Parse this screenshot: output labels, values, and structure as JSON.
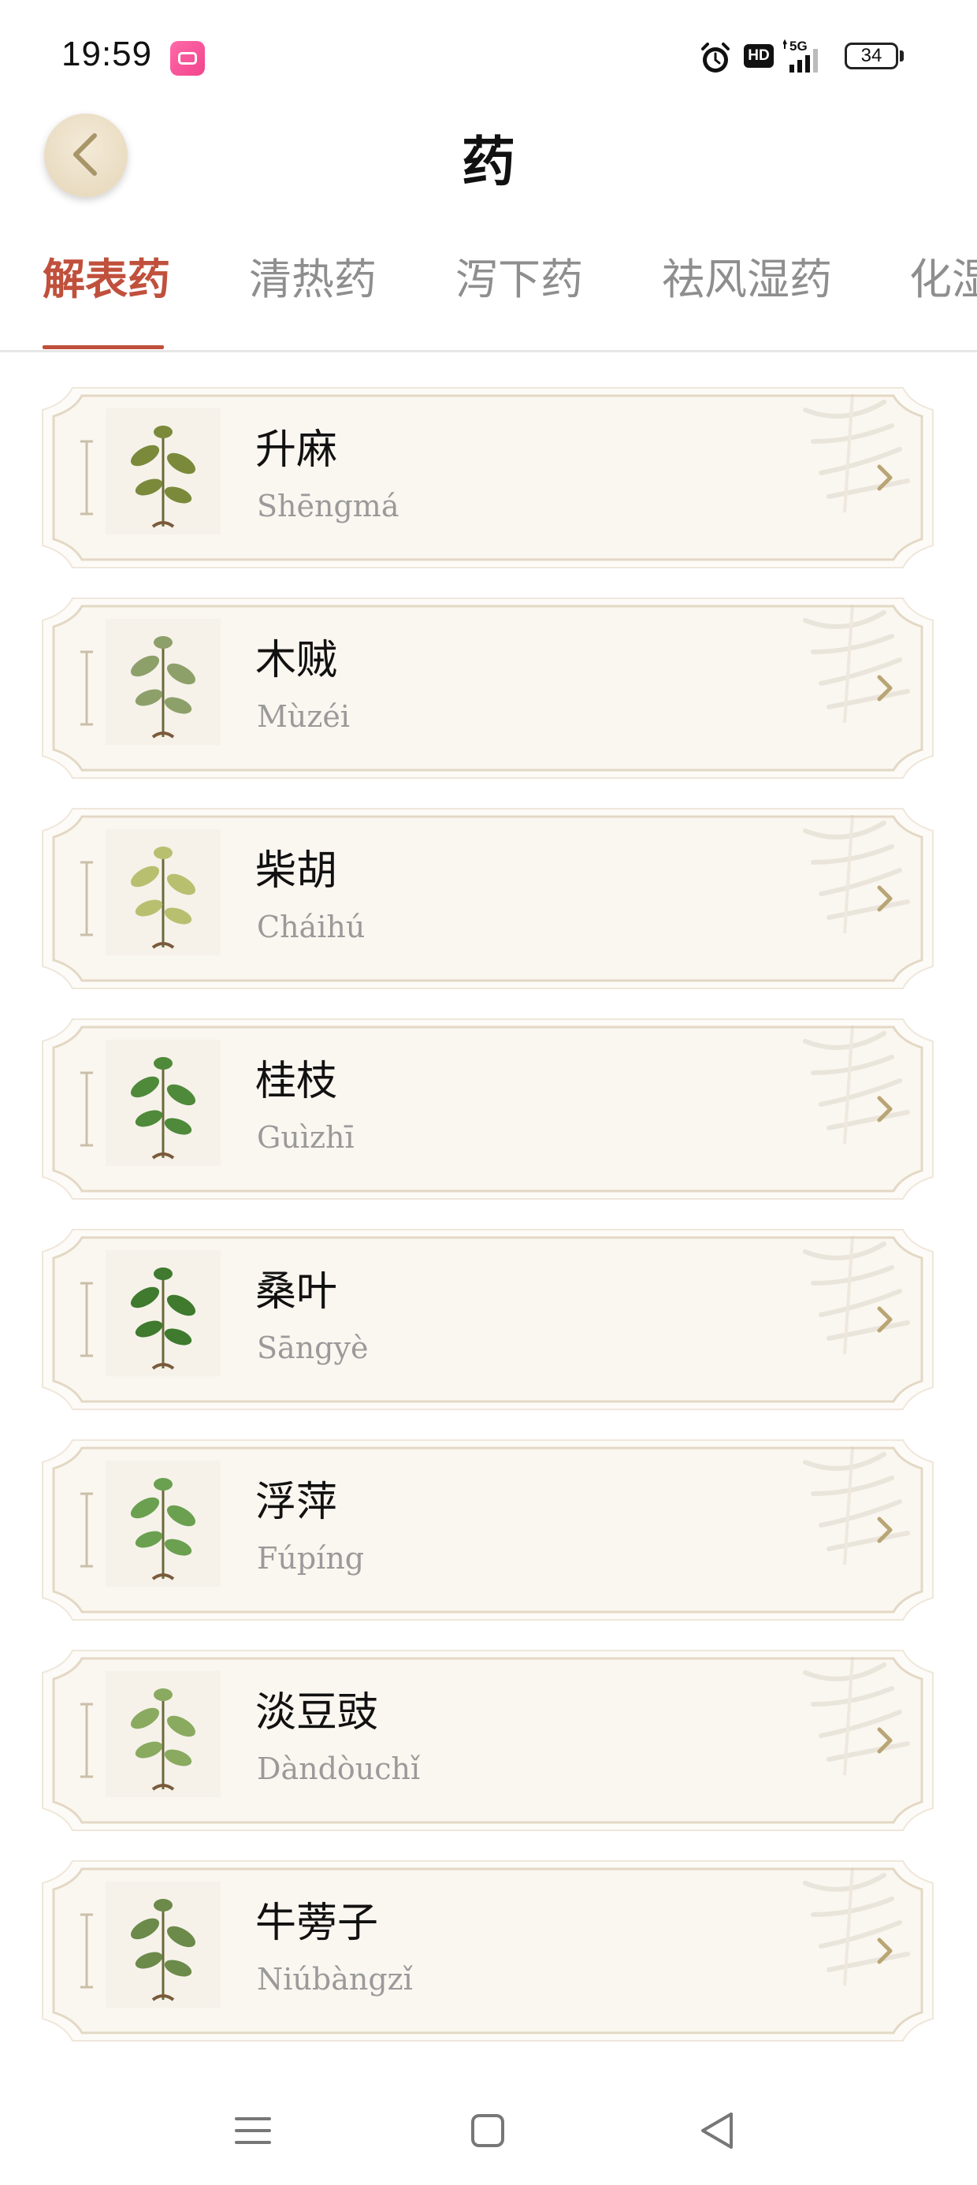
{
  "status_bar": {
    "time": "19:59",
    "hd_label": "HD",
    "network": "5G",
    "battery": "34"
  },
  "header": {
    "title": "药"
  },
  "tabs": [
    {
      "label": "解表药",
      "active": true
    },
    {
      "label": "清热药",
      "active": false
    },
    {
      "label": "泻下药",
      "active": false
    },
    {
      "label": "祛风湿药",
      "active": false
    },
    {
      "label": "化湿",
      "active": false
    }
  ],
  "herbs": [
    {
      "name": "升麻",
      "pinyin": "Shēngmá",
      "icon": "shengma-plant-illustration"
    },
    {
      "name": "木贼",
      "pinyin": "Mùzéi",
      "icon": "muzei-plant-illustration"
    },
    {
      "name": "柴胡",
      "pinyin": "Cháihú",
      "icon": "chaihu-plant-illustration"
    },
    {
      "name": "桂枝",
      "pinyin": "Guìzhī",
      "icon": "guizhi-plant-illustration"
    },
    {
      "name": "桑叶",
      "pinyin": "Sāngyè",
      "icon": "sangye-plant-illustration"
    },
    {
      "name": "浮萍",
      "pinyin": "Fúpíng",
      "icon": "fuping-plant-illustration"
    },
    {
      "name": "淡豆豉",
      "pinyin": "Dàndòuchǐ",
      "icon": "dandouchi-plant-illustration"
    },
    {
      "name": "牛蒡子",
      "pinyin": "Niúbàngzǐ",
      "icon": "niubangzi-plant-illustration"
    }
  ],
  "colors": {
    "accent": "#c0503c",
    "card_bg": "#fbf8f4",
    "card_border": "#e6dccb"
  }
}
